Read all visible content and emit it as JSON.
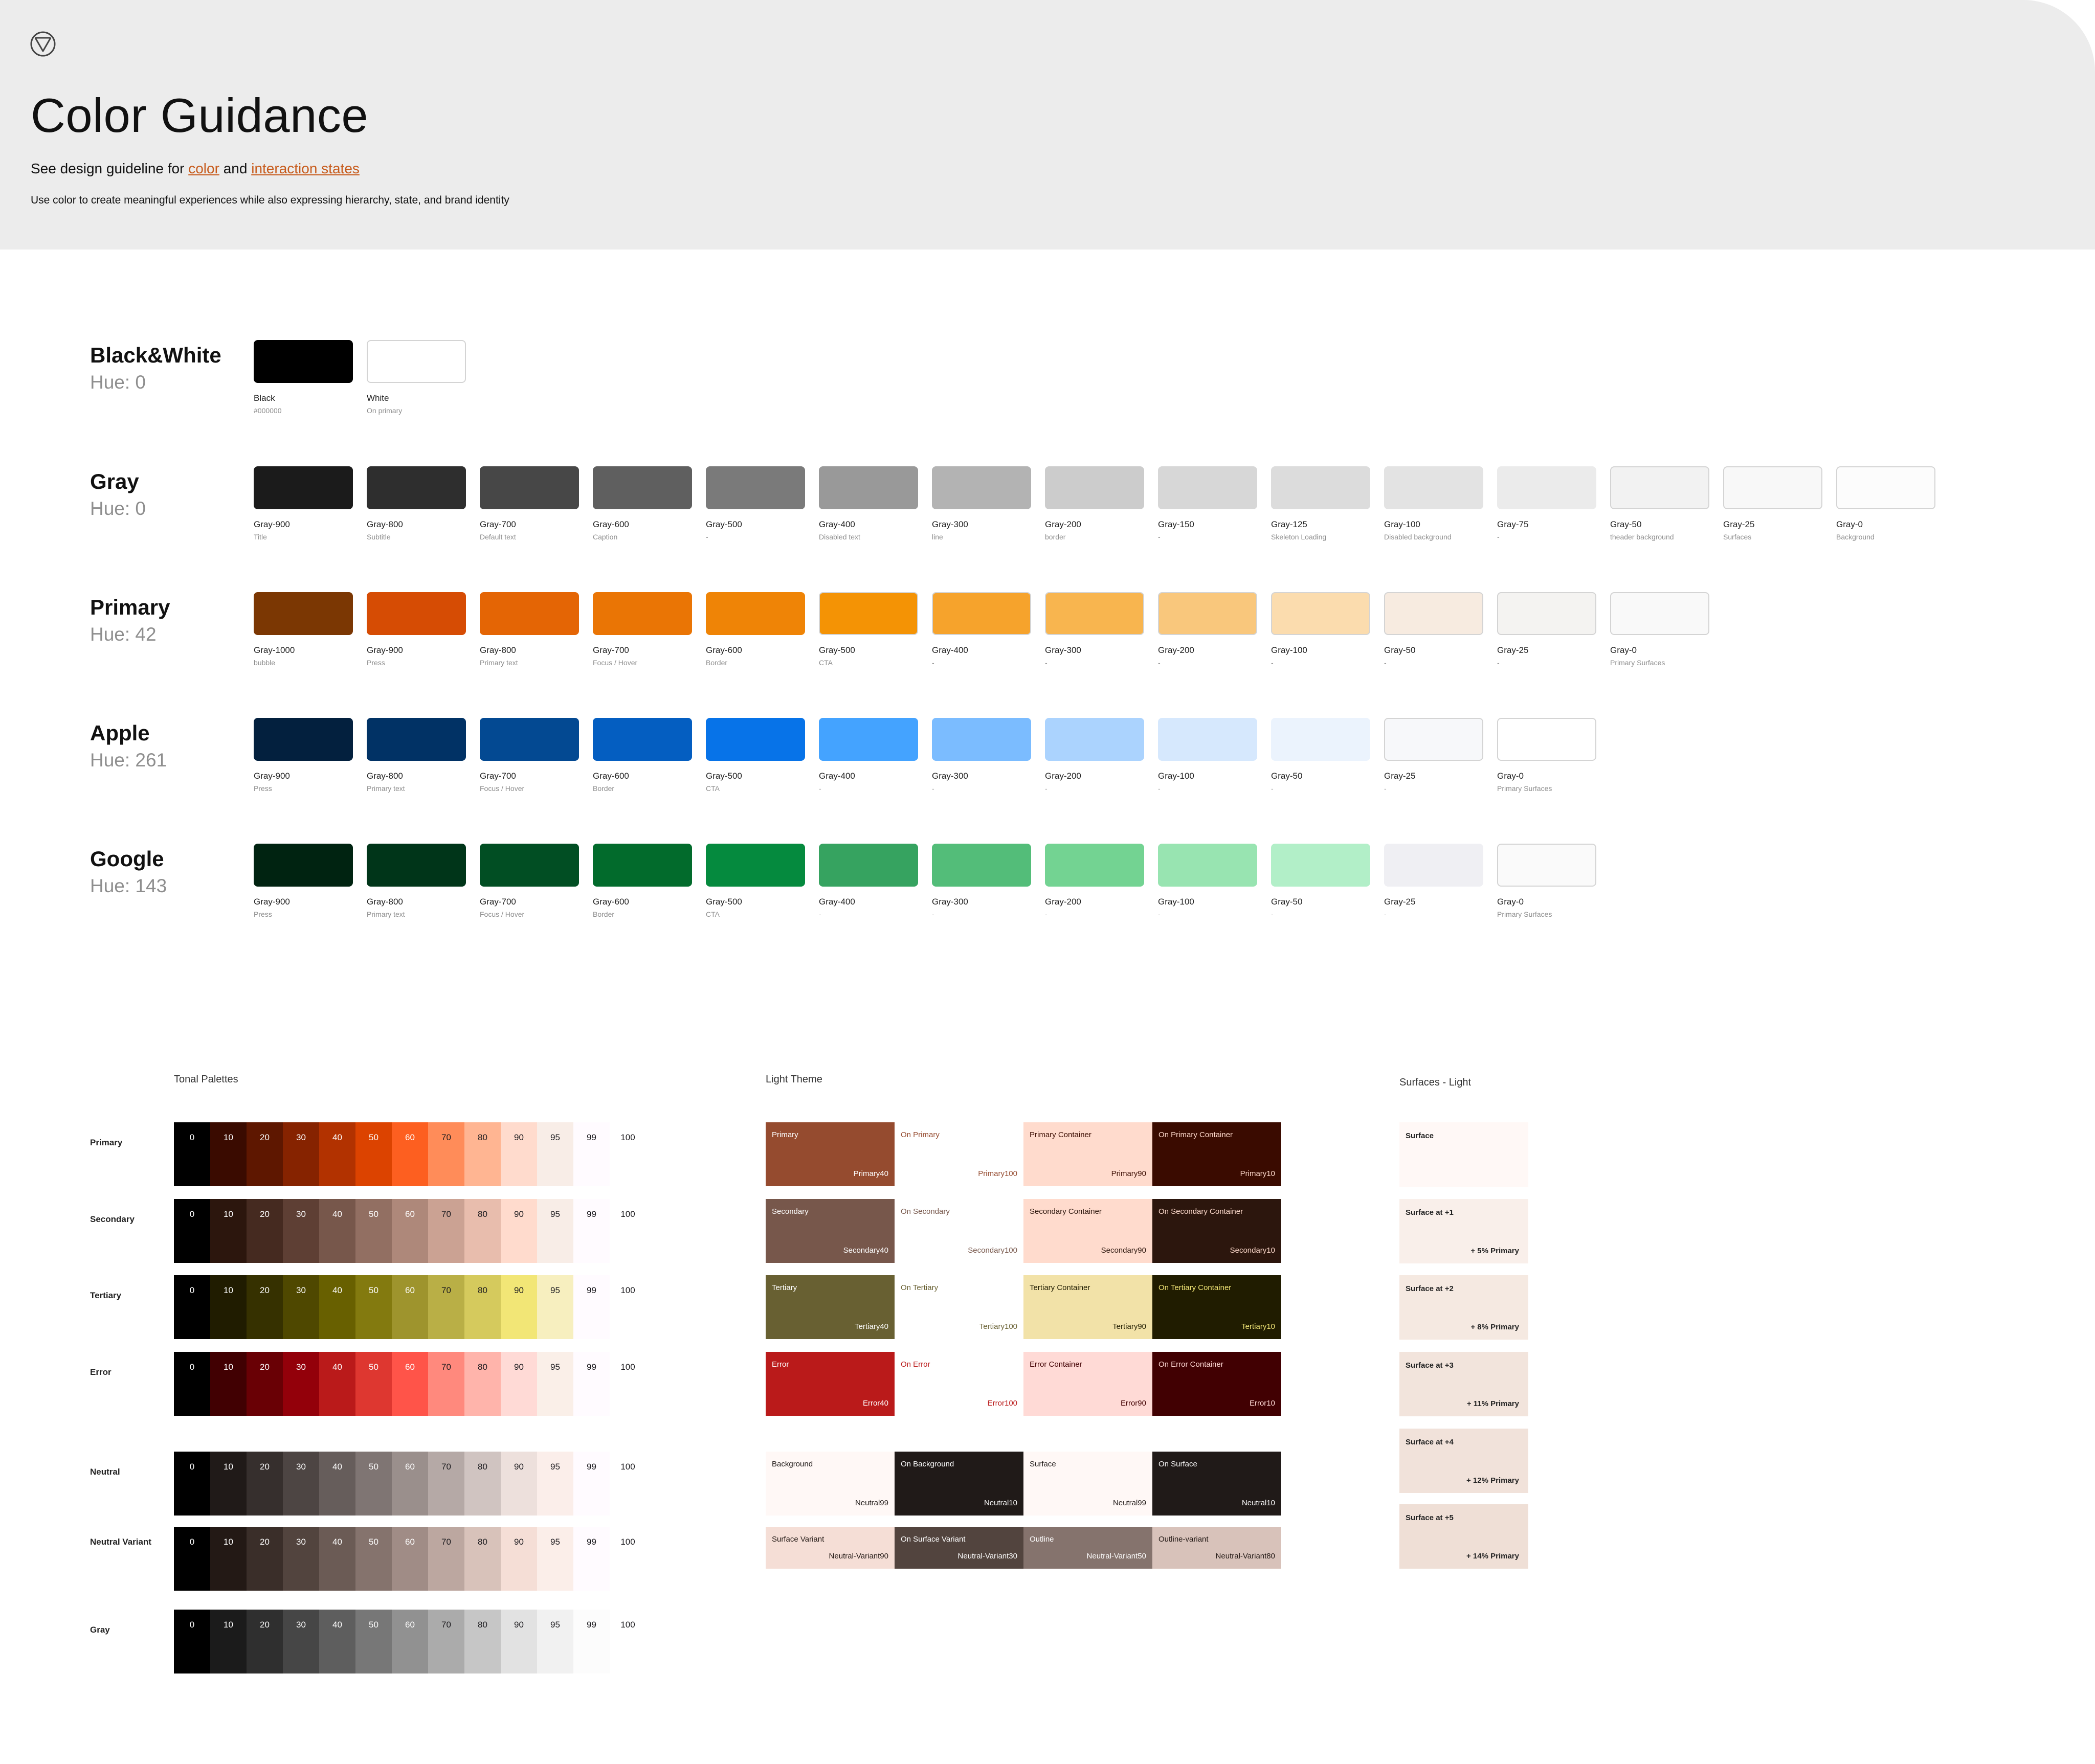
{
  "header": {
    "title": "Color Guidance",
    "guideline_prefix": "See design guideline for",
    "guideline_link1": "color",
    "guideline_and": "and",
    "guideline_link2": "interaction states",
    "description": "Use color to create meaningful experiences while also expressing hierarchy, state, and brand identity"
  },
  "palettes": [
    {
      "name": "Black&White",
      "hue": "Hue: 0",
      "swatches": [
        {
          "name": "Black",
          "sub": "#000000",
          "color": "#000000"
        },
        {
          "name": "White",
          "sub": "On primary",
          "color": "#ffffff"
        }
      ]
    },
    {
      "name": "Gray",
      "hue": "Hue: 0",
      "swatches": [
        {
          "name": "Gray-900",
          "sub": "Title",
          "color": "#1b1b1b"
        },
        {
          "name": "Gray-800",
          "sub": "Subtitle",
          "color": "#2e2e2e"
        },
        {
          "name": "Gray-700",
          "sub": "Default text",
          "color": "#474747"
        },
        {
          "name": "Gray-600",
          "sub": "Caption",
          "color": "#5f5f5f"
        },
        {
          "name": "Gray-500",
          "sub": "-",
          "color": "#7a7a7a"
        },
        {
          "name": "Gray-400",
          "sub": "Disabled text",
          "color": "#999999"
        },
        {
          "name": "Gray-300",
          "sub": "line",
          "color": "#b3b3b3"
        },
        {
          "name": "Gray-200",
          "sub": "border",
          "color": "#cccccc"
        },
        {
          "name": "Gray-150",
          "sub": "-",
          "color": "#d7d7d7"
        },
        {
          "name": "Gray-125",
          "sub": "Skeleton Loading",
          "color": "#dcdcdc"
        },
        {
          "name": "Gray-100",
          "sub": "Disabled background",
          "color": "#e3e3e3"
        },
        {
          "name": "Gray-75",
          "sub": "-",
          "color": "#ebebeb"
        },
        {
          "name": "Gray-50",
          "sub": "theader background",
          "color": "#f2f2f2"
        },
        {
          "name": "Gray-25",
          "sub": "Surfaces",
          "color": "#f8f8f8"
        },
        {
          "name": "Gray-0",
          "sub": "Background",
          "color": "#fcfcfc"
        }
      ]
    },
    {
      "name": "Primary",
      "hue": "Hue: 42",
      "swatches": [
        {
          "name": "Gray-1000",
          "sub": "bubble",
          "color": "#7b3703"
        },
        {
          "name": "Gray-900",
          "sub": "Press",
          "color": "#d64c04"
        },
        {
          "name": "Gray-800",
          "sub": "Primary text",
          "color": "#e46505"
        },
        {
          "name": "Gray-700",
          "sub": "Focus / Hover",
          "color": "#ea7505"
        },
        {
          "name": "Gray-600",
          "sub": "Border",
          "color": "#ef8406"
        },
        {
          "name": "Gray-500",
          "sub": "CTA",
          "color": "#f49305"
        },
        {
          "name": "Gray-400",
          "sub": "-",
          "color": "#f6a32c"
        },
        {
          "name": "Gray-300",
          "sub": "-",
          "color": "#f8b54f"
        },
        {
          "name": "Gray-200",
          "sub": "-",
          "color": "#f9c77c"
        },
        {
          "name": "Gray-100",
          "sub": "-",
          "color": "#fbdcae"
        },
        {
          "name": "Gray-50",
          "sub": "-",
          "color": "#f7ebe0"
        },
        {
          "name": "Gray-25",
          "sub": "-",
          "color": "#f4f3f1"
        },
        {
          "name": "Gray-0",
          "sub": "Primary Surfaces",
          "color": "#f9f9f9"
        }
      ]
    },
    {
      "name": "Apple",
      "hue": "Hue: 261",
      "swatches": [
        {
          "name": "Gray-900",
          "sub": "Press",
          "color": "#03203e"
        },
        {
          "name": "Gray-800",
          "sub": "Primary text",
          "color": "#013265"
        },
        {
          "name": "Gray-700",
          "sub": "Focus / Hover",
          "color": "#034992"
        },
        {
          "name": "Gray-600",
          "sub": "Border",
          "color": "#045ec1"
        },
        {
          "name": "Gray-500",
          "sub": "CTA",
          "color": "#0773e8"
        },
        {
          "name": "Gray-400",
          "sub": "-",
          "color": "#44a3ff"
        },
        {
          "name": "Gray-300",
          "sub": "-",
          "color": "#7bbcff"
        },
        {
          "name": "Gray-200",
          "sub": "-",
          "color": "#abd3fe"
        },
        {
          "name": "Gray-100",
          "sub": "-",
          "color": "#d6e8fd"
        },
        {
          "name": "Gray-50",
          "sub": "-",
          "color": "#ebf3fd"
        },
        {
          "name": "Gray-25",
          "sub": "-",
          "color": "#f7f8fa"
        },
        {
          "name": "Gray-0",
          "sub": "Primary Surfaces",
          "color": "#ffffff"
        }
      ]
    },
    {
      "name": "Google",
      "hue": "Hue: 143",
      "swatches": [
        {
          "name": "Gray-900",
          "sub": "Press",
          "color": "#002311"
        },
        {
          "name": "Gray-800",
          "sub": "Primary text",
          "color": "#003519"
        },
        {
          "name": "Gray-700",
          "sub": "Focus / Hover",
          "color": "#014e23"
        },
        {
          "name": "Gray-600",
          "sub": "Border",
          "color": "#026b2c"
        },
        {
          "name": "Gray-500",
          "sub": "CTA",
          "color": "#058a3e"
        },
        {
          "name": "Gray-400",
          "sub": "-",
          "color": "#36a360"
        },
        {
          "name": "Gray-300",
          "sub": "-",
          "color": "#53bd79"
        },
        {
          "name": "Gray-200",
          "sub": "-",
          "color": "#73d392"
        },
        {
          "name": "Gray-100",
          "sub": "-",
          "color": "#98e4b1"
        },
        {
          "name": "Gray-50",
          "sub": "-",
          "color": "#b2efc8"
        },
        {
          "name": "Gray-25",
          "sub": "-",
          "color": "#efeff3"
        },
        {
          "name": "Gray-0",
          "sub": "Primary Surfaces",
          "color": "#fafafa"
        }
      ]
    }
  ],
  "tonal": {
    "title": "Tonal Palettes",
    "tones": [
      "0",
      "10",
      "20",
      "30",
      "40",
      "50",
      "60",
      "70",
      "80",
      "90",
      "95",
      "99",
      "100"
    ],
    "rows": [
      {
        "name": "Primary",
        "colors": [
          "#000000",
          "#3a0b00",
          "#5e1700",
          "#862300",
          "#b23200",
          "#dc4300",
          "#fd5f20",
          "#ff8c59",
          "#ffb592",
          "#ffdbcd",
          "#f8ede7",
          "#fffbff",
          "#ffffff"
        ]
      },
      {
        "name": "Secondary",
        "colors": [
          "#000000",
          "#2c160d",
          "#452a20",
          "#5e3f34",
          "#77574b",
          "#926f62",
          "#ae887a",
          "#cba293",
          "#e8bdad",
          "#ffdbcd",
          "#f8ede7",
          "#fffbff",
          "#ffffff"
        ]
      },
      {
        "name": "Tertiary",
        "colors": [
          "#000000",
          "#201c00",
          "#363100",
          "#4f4800",
          "#686000",
          "#837a0f",
          "#9e942d",
          "#b9af46",
          "#d5ca5d",
          "#f2e676",
          "#f7efbf",
          "#fffbff",
          "#ffffff"
        ]
      },
      {
        "name": "Error",
        "colors": [
          "#000000",
          "#410002",
          "#690005",
          "#93000a",
          "#ba1a1a",
          "#de3730",
          "#ff5449",
          "#ff897d",
          "#ffb4ab",
          "#ffdad6",
          "#faefe8",
          "#fffbff",
          "#ffffff"
        ]
      },
      {
        "name": "Neutral",
        "colors": [
          "#000000",
          "#201a18",
          "#362f2d",
          "#4d4543",
          "#665d5b",
          "#7f7573",
          "#9a8f8c",
          "#b5a9a6",
          "#d0c4c1",
          "#ede0dc",
          "#fbeeea",
          "#fffbff",
          "#ffffff"
        ]
      },
      {
        "name": "Neutral Variant",
        "colors": [
          "#000000",
          "#231915",
          "#3a2e29",
          "#52443e",
          "#6b5b55",
          "#85736d",
          "#a08c86",
          "#bca7a0",
          "#d8c2ba",
          "#f5ded6",
          "#fbeee9",
          "#fffbff",
          "#ffffff"
        ]
      },
      {
        "name": "Gray",
        "colors": [
          "#000000",
          "#1b1b1b",
          "#2f2f2f",
          "#464646",
          "#5e5e5e",
          "#777777",
          "#919191",
          "#ababab",
          "#c6c6c6",
          "#e2e2e2",
          "#f1f1f1",
          "#fcfcfc",
          "#ffffff"
        ]
      }
    ]
  },
  "theme": {
    "title": "Light Theme",
    "rows": [
      [
        {
          "name": "Primary",
          "tone": "Primary40",
          "bg": "#954b2f",
          "fg": "#ffffff"
        },
        {
          "name": "On Primary",
          "tone": "Primary100",
          "bg": "#ffffff",
          "fg": "#954b2f"
        },
        {
          "name": "Primary Container",
          "tone": "Primary90",
          "bg": "#ffdbcd",
          "fg": "#3a0b00"
        },
        {
          "name": "On Primary Container",
          "tone": "Primary10",
          "bg": "#3a0b00",
          "fg": "#ffdbcd"
        }
      ],
      [
        {
          "name": "Secondary",
          "tone": "Secondary40",
          "bg": "#77574b",
          "fg": "#ffffff"
        },
        {
          "name": "On Secondary",
          "tone": "Secondary100",
          "bg": "#ffffff",
          "fg": "#77574b"
        },
        {
          "name": "Secondary Container",
          "tone": "Secondary90",
          "bg": "#ffdbcd",
          "fg": "#2c160d"
        },
        {
          "name": "On Secondary Container",
          "tone": "Secondary10",
          "bg": "#2c160d",
          "fg": "#ffdbcd"
        }
      ],
      [
        {
          "name": "Tertiary",
          "tone": "Tertiary40",
          "bg": "#686032",
          "fg": "#ffffff"
        },
        {
          "name": "On Tertiary",
          "tone": "Tertiary100",
          "bg": "#ffffff",
          "fg": "#686032"
        },
        {
          "name": "Tertiary Container",
          "tone": "Tertiary90",
          "bg": "#f2e2a8",
          "fg": "#201c00"
        },
        {
          "name": "On Tertiary Container",
          "tone": "Tertiary10",
          "bg": "#201c00",
          "fg": "#f2e676"
        }
      ],
      [
        {
          "name": "Error",
          "tone": "Error40",
          "bg": "#ba1a1a",
          "fg": "#ffffff"
        },
        {
          "name": "On Error",
          "tone": "Error100",
          "bg": "#ffffff",
          "fg": "#ba1a1a"
        },
        {
          "name": "Error Container",
          "tone": "Error90",
          "bg": "#ffdad6",
          "fg": "#410002"
        },
        {
          "name": "On Error Container",
          "tone": "Error10",
          "bg": "#410002",
          "fg": "#ffdad6"
        }
      ]
    ],
    "neutral_rows": [
      [
        {
          "name": "Background",
          "tone": "Neutral99",
          "bg": "#fff8f6",
          "fg": "#201a18"
        },
        {
          "name": "On Background",
          "tone": "Neutral10",
          "bg": "#201a18",
          "fg": "#ffffff"
        },
        {
          "name": "Surface",
          "tone": "Neutral99",
          "bg": "#fff8f6",
          "fg": "#201a18"
        },
        {
          "name": "On Surface",
          "tone": "Neutral10",
          "bg": "#201a18",
          "fg": "#ffffff"
        }
      ],
      [
        {
          "name": "Surface Variant",
          "tone": "Neutral-Variant90",
          "bg": "#f5ded6",
          "fg": "#231915"
        },
        {
          "name": "On Surface Variant",
          "tone": "Neutral-Variant30",
          "bg": "#52443e",
          "fg": "#ffffff"
        },
        {
          "name": "Outline",
          "tone": "Neutral-Variant50",
          "bg": "#85736d",
          "fg": "#ffffff"
        },
        {
          "name": "Outline-variant",
          "tone": "Neutral-Variant80",
          "bg": "#d8c2ba",
          "fg": "#231915"
        }
      ]
    ]
  },
  "surfaces": {
    "title": "Surfaces - Light",
    "items": [
      {
        "name": "Surface",
        "tint": "",
        "bg": "#fff8f6"
      },
      {
        "name": "Surface at +1",
        "tint": "+ 5% Primary",
        "bg": "#f9efea"
      },
      {
        "name": "Surface at +2",
        "tint": "+ 8% Primary",
        "bg": "#f5e9e1"
      },
      {
        "name": "Surface at +3",
        "tint": "+ 11% Primary",
        "bg": "#f2e4dc"
      },
      {
        "name": "Surface at +4",
        "tint": "+ 12% Primary",
        "bg": "#f1e2da"
      },
      {
        "name": "Surface at +5",
        "tint": "+ 14% Primary",
        "bg": "#efdfd6"
      }
    ]
  }
}
